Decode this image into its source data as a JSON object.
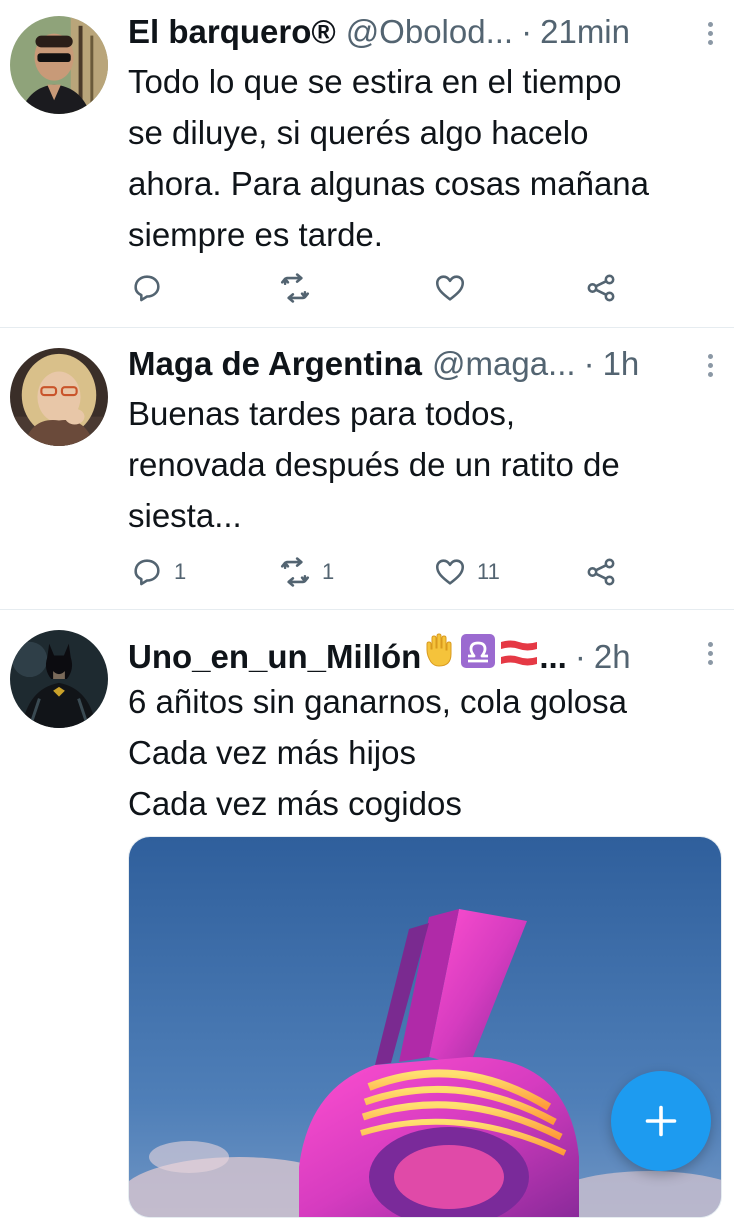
{
  "tweets": [
    {
      "name": "El barquero®",
      "handle": "@Obolod...",
      "separator": "·",
      "time": "21min",
      "avatar_icon": "avatar-man-sunglasses",
      "text_lines": [
        "Todo lo que se estira en el tiempo",
        "se diluye, si querés algo hacelo",
        "ahora. Para algunas cosas mañana",
        "siempre es tarde."
      ],
      "reply_count": "",
      "retweet_count": "",
      "like_count": ""
    },
    {
      "name": "Maga de Argentina",
      "handle": "@maga...",
      "separator": "·",
      "time": "1h",
      "avatar_icon": "avatar-woman-blonde",
      "text_lines": [
        "Buenas tardes para todos,",
        "renovada después de un ratito de",
        "siesta..."
      ],
      "reply_count": "1",
      "retweet_count": "1",
      "like_count": "11"
    },
    {
      "name": "Uno_en_un_Millón",
      "name_suffix": "...",
      "emojis": [
        "raised-hand-emoji",
        "libra-emoji",
        "austria-flag-emoji"
      ],
      "separator": "·",
      "time": "2h",
      "avatar_icon": "avatar-dark-knight",
      "text_lines": [
        "6 añitos sin ganarnos, cola golosa",
        "Cada vez más hijos",
        "Cada vez más cogidos"
      ],
      "media_icon": "pink-number-six-sculpture-image"
    }
  ],
  "compose_button_icon": "plus-icon",
  "colors": {
    "accent": "#1d9bf0",
    "text": "#0f1419",
    "secondary": "#536471",
    "divider": "#e6ecf0"
  }
}
